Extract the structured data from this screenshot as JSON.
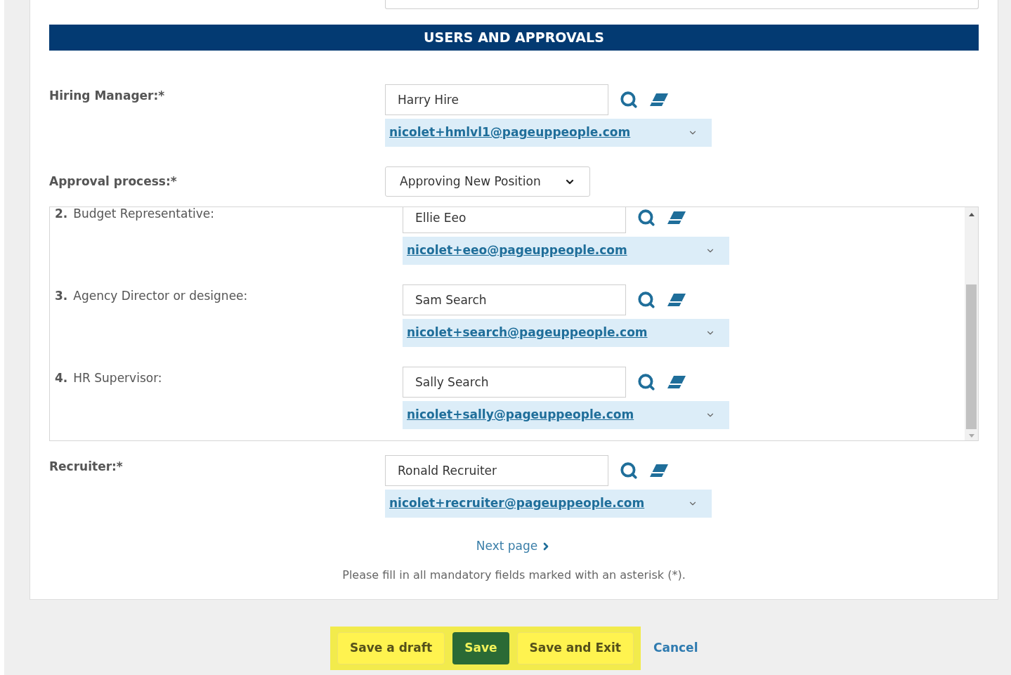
{
  "section_title": "USERS AND APPROVALS",
  "hiring_manager": {
    "label": "Hiring Manager:*",
    "value": "Harry Hire",
    "email": "nicolet+hmlvl1@pageuppeople.com"
  },
  "approval_process": {
    "label": "Approval process:*",
    "value": "Approving New Position"
  },
  "approvers": [
    {
      "number": "2.",
      "label": "Budget Representative:",
      "value": "Ellie Eeo",
      "email": "nicolet+eeo@pageuppeople.com"
    },
    {
      "number": "3.",
      "label": "Agency Director or designee:",
      "value": "Sam Search",
      "email": "nicolet+search@pageuppeople.com"
    },
    {
      "number": "4.",
      "label": "HR Supervisor:",
      "value": "Sally Search",
      "email": "nicolet+sally@pageuppeople.com"
    }
  ],
  "recruiter": {
    "label": "Recruiter:*",
    "value": "Ronald Recruiter",
    "email": "nicolet+recruiter@pageuppeople.com"
  },
  "next_page": "Next page",
  "note": "Please fill in all mandatory fields marked with an asterisk (*).",
  "buttons": [
    {
      "label": "Save a draft",
      "kind": "secondary"
    },
    {
      "label": "Save",
      "kind": "primary"
    },
    {
      "label": "Save and Exit",
      "kind": "secondary"
    }
  ],
  "cancel": "Cancel"
}
